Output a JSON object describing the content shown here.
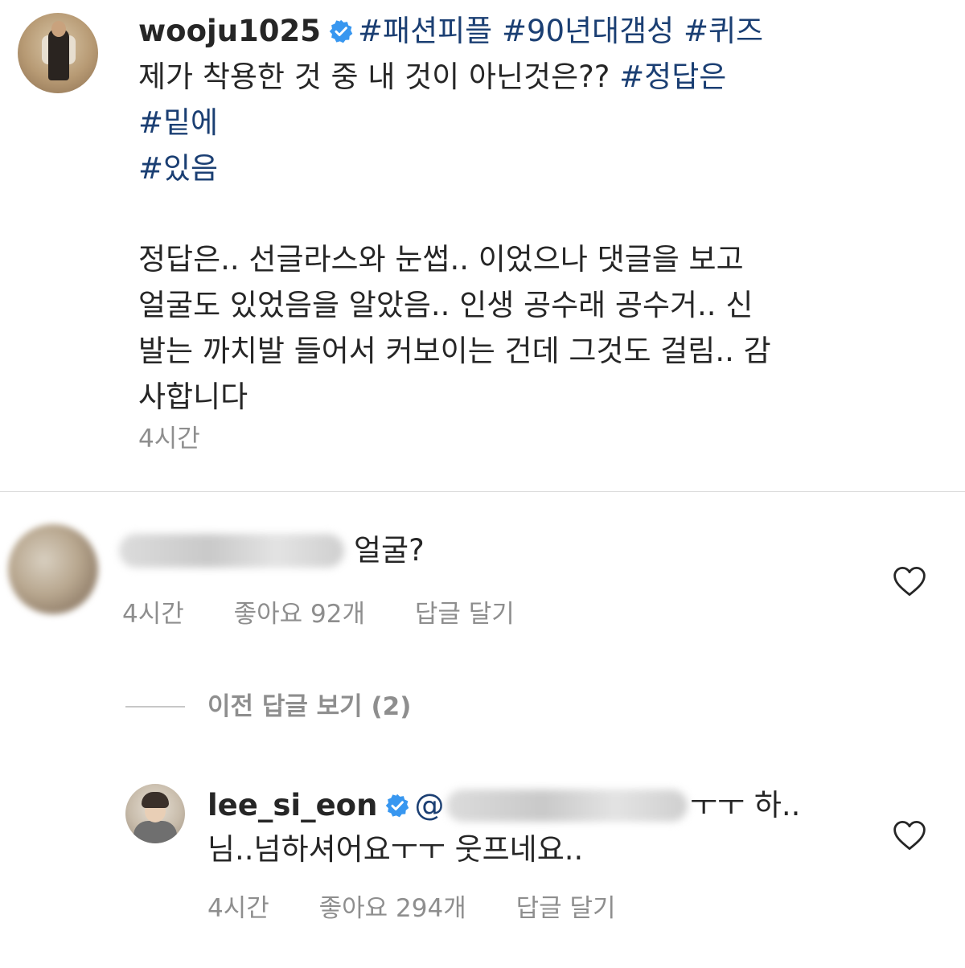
{
  "caption": {
    "username": "wooju1025",
    "hashtags_line1": "#패션피플 #90년대갬성 #퀴즈",
    "text_line2": "제가 착용한 것 중 내 것이 아닌것은?? ",
    "hashtag_line2": "#정답은",
    "hashtag_line3": "#밑에",
    "hashtag_line4": "#있음",
    "body_lines": [
      "정답은.. 선글라스와 눈썹.. 이었으나 댓글을 보고",
      "얼굴도 있었음을 알았음.. 인생 공수래 공수거.. 신",
      "발는 까치발 들어서 커보이는 건데 그것도 걸림.. 감",
      "사합니다"
    ],
    "time": "4시간"
  },
  "comment1": {
    "text": "얼굴?",
    "time": "4시간",
    "likes": "좋아요 92개",
    "reply_label": "답글 달기"
  },
  "view_previous_replies": "이전 답글 보기 (2)",
  "reply1": {
    "username": "lee_si_eon",
    "mention_prefix": "@",
    "text_line1_end": "ㅜㅜ 하..",
    "text_line2": "님..넘하셔어요ㅜㅜ 웃프네요..",
    "time": "4시간",
    "likes": "좋아요 294개",
    "reply_label": "답글 달기"
  },
  "colors": {
    "hashtag": "#1b3f73",
    "verified_badge": "#3897f0",
    "meta_text": "#8e8e8e",
    "divider": "#dbdbdb"
  },
  "icons": [
    "verified-badge-icon",
    "heart-icon"
  ]
}
